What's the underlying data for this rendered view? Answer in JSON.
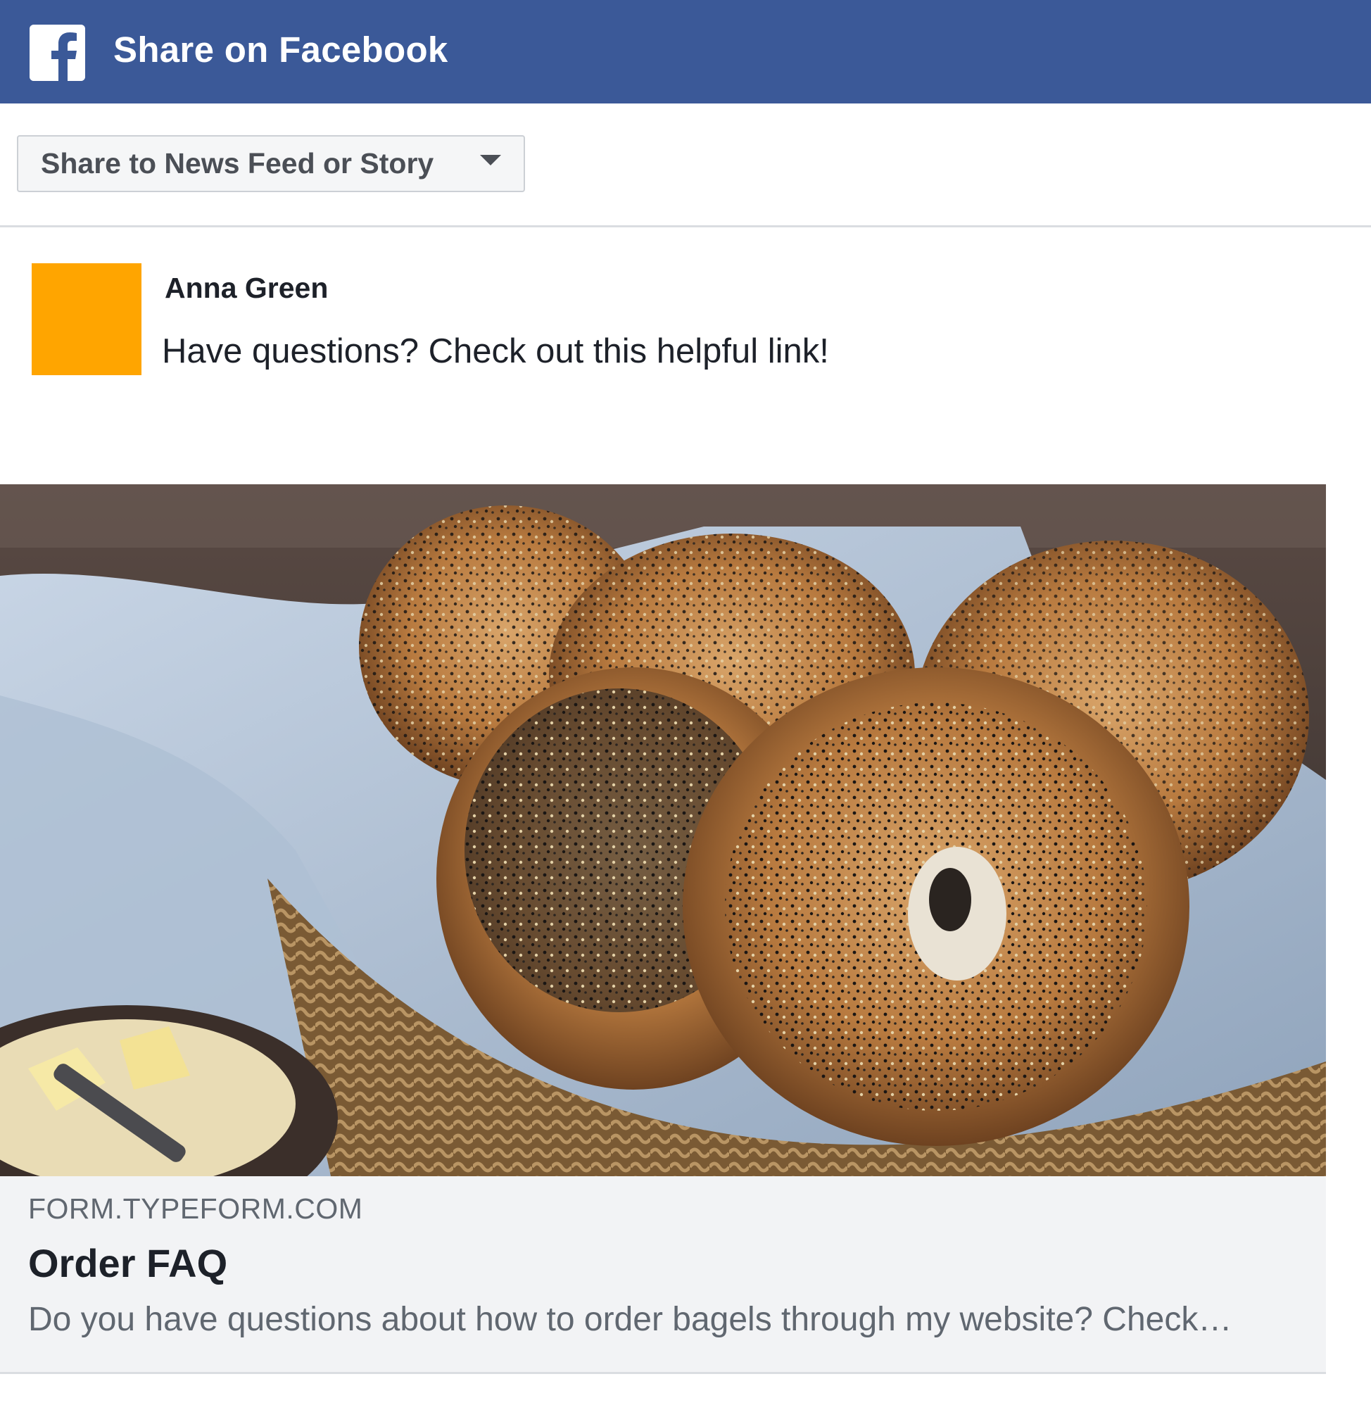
{
  "header": {
    "title": "Share on Facebook",
    "logo_icon": "facebook-icon",
    "background_color": "#3b5998"
  },
  "share_target": {
    "selected": "Share to News Feed or Story",
    "dropdown_icon": "caret-down-icon"
  },
  "post": {
    "author": "Anna Green",
    "avatar_color": "#ffa500",
    "message": "Have questions? Check out this helpful link!"
  },
  "link_preview": {
    "domain": "FORM.TYPEFORM.COM",
    "title": "Order FAQ",
    "description": "Do you have questions about how to order bagels through my website? Check…"
  }
}
